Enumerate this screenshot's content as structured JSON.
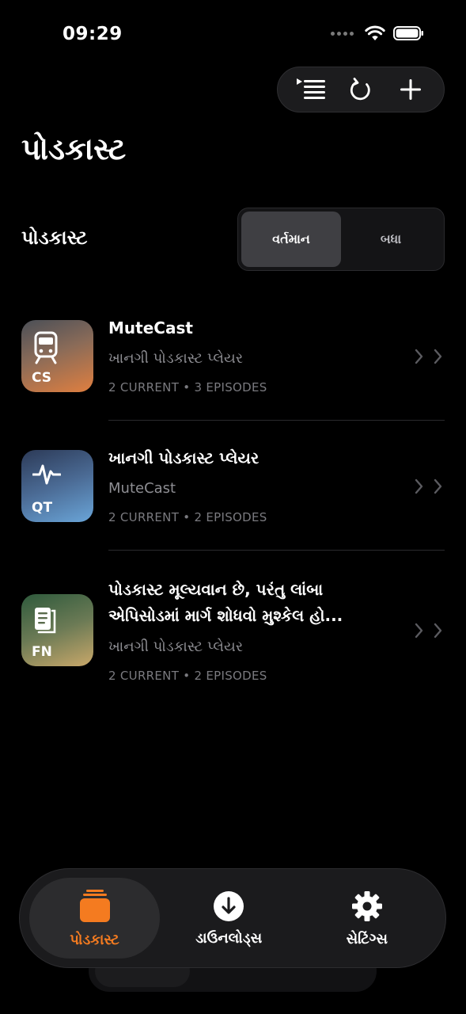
{
  "status_bar": {
    "time": "09:29"
  },
  "toolbar": {
    "icons": [
      "queue-list-icon",
      "refresh-icon",
      "add-icon"
    ]
  },
  "page_title": "પોડકાસ્ટ",
  "section": {
    "heading": "પોડકાસ્ટ",
    "segments": [
      {
        "label": "વર્તમાન",
        "selected": true
      },
      {
        "label": "બધા",
        "selected": false
      }
    ]
  },
  "podcasts": [
    {
      "abbr": "CS",
      "icon": "train-icon",
      "title": "MuteCast",
      "subtitle": "ખાનગી પોડકાસ્ટ પ્લેયર",
      "meta": "2 CURRENT • 3 EPISODES",
      "colors": [
        "#4a4f57",
        "#e07f40"
      ]
    },
    {
      "abbr": "QT",
      "icon": "pulse-icon",
      "title": "ખાનગી પોડકાસ્ટ પ્લેયર",
      "subtitle": "MuteCast",
      "meta": "2 CURRENT • 2 EPISODES",
      "colors": [
        "#2c3a57",
        "#6aa5d8"
      ]
    },
    {
      "abbr": "FN",
      "icon": "document-icon",
      "title_line1": "પોડકાસ્ટ મૂલ્યવાન છે, પરંતુ લાંબા",
      "title_line2": "એપિસોડમાં માર્ગ શોધવો મુશ્કેલ હો...",
      "subtitle": "ખાનગી પોડકાસ્ટ પ્લેયર",
      "meta": "2 CURRENT • 2 EPISODES",
      "colors": [
        "#2e5a3c",
        "#c9a86a"
      ]
    }
  ],
  "tabbar": {
    "tabs": [
      {
        "label": "પોડકાસ્ટ",
        "icon": "podcasts-stack-icon",
        "active": true
      },
      {
        "label": "ડાઉનલોડ્સ",
        "icon": "download-icon",
        "active": false
      },
      {
        "label": "સેટિંગ્સ",
        "icon": "gear-icon",
        "active": false
      }
    ],
    "accent": "#f47b20"
  }
}
